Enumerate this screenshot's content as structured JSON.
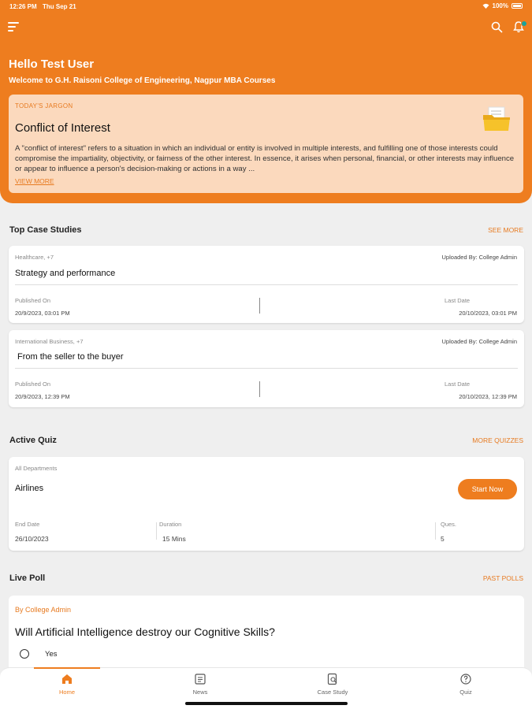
{
  "status_bar": {
    "time": "12:26 PM",
    "date": "Thu Sep 21",
    "battery": "100%"
  },
  "header": {
    "greeting": "Hello Test User",
    "welcome": "Welcome to G.H. Raisoni College of Engineering,  Nagpur MBA Courses"
  },
  "jargon": {
    "tag": "TODAY'S JARGON",
    "title": "Conflict of Interest",
    "body": "A \"conflict of interest\" refers to a situation in which an individual or entity is involved in multiple interests, and fulfilling one of those interests could compromise the impartiality, objectivity, or fairness of the other interest. In essence, it arises when personal, financial, or other interests may influence or appear to influence a person's decision-making or actions in a way ...",
    "link": "VIEW MORE"
  },
  "case_studies": {
    "title": "Top Case Studies",
    "link": "SEE MORE",
    "items": [
      {
        "category": "Healthcare, +7",
        "uploaded": "Uploaded By: College Admin",
        "title": "Strategy and performance",
        "published_label": "Published On",
        "published": "20/9/2023, 03:01 PM",
        "last_label": "Last Date",
        "last": "20/10/2023, 03:01 PM"
      },
      {
        "category": "International Business, +7",
        "uploaded": "Uploaded By: College Admin",
        "title": "From the seller to the buyer",
        "published_label": "Published On",
        "published": "20/9/2023, 12:39 PM",
        "last_label": "Last Date",
        "last": "20/10/2023, 12:39 PM"
      }
    ]
  },
  "quiz": {
    "title": "Active Quiz",
    "link": "MORE QUIZZES",
    "department": "All Departments",
    "name": "Airlines",
    "button": "Start Now",
    "end_label": "End Date",
    "end": "26/10/2023",
    "duration_label": "Duration",
    "duration": "15 Mins",
    "ques_label": "Ques.",
    "ques": "5"
  },
  "poll": {
    "title": "Live Poll",
    "link": "PAST POLLS",
    "by": "By College Admin",
    "question": "Will Artificial Intelligence destroy our Cognitive Skills?",
    "option": "Yes"
  },
  "nav": {
    "home": "Home",
    "news": "News",
    "case_study": "Case Study",
    "quiz": "Quiz"
  },
  "colors": {
    "accent": "#ee7d1f",
    "jargon_bg": "#fbd9bd",
    "badge": "#1aa39a"
  }
}
